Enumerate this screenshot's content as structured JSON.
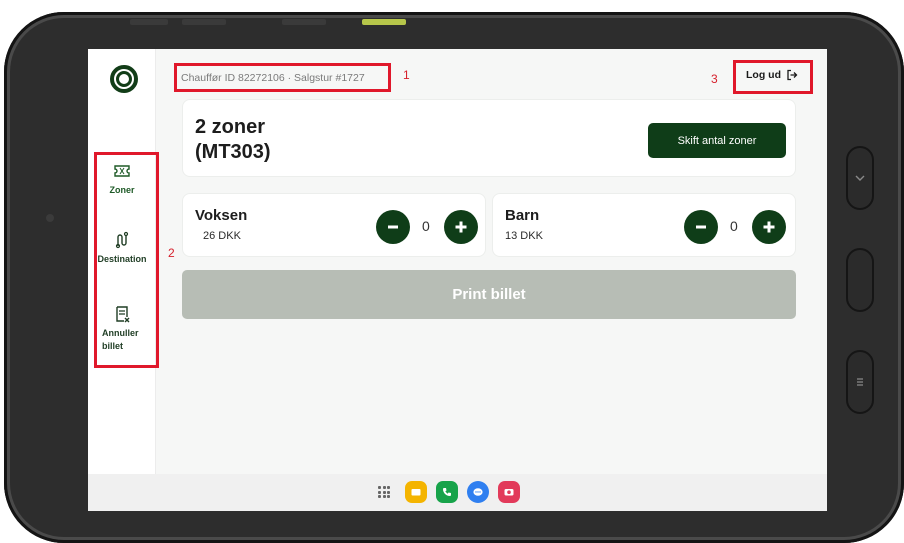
{
  "header": {
    "driver_info": "Chauffør ID 82272106 · Salgstur #1727",
    "logout_label": "Log ud"
  },
  "sidebar": {
    "items": [
      {
        "label": "Zoner",
        "icon": "ticket-icon",
        "active": true
      },
      {
        "label": "Destination",
        "icon": "route-icon",
        "active": false
      },
      {
        "label": "Annuller billet",
        "icon": "cancel-receipt-icon",
        "active": false
      }
    ]
  },
  "zone": {
    "title_line1": "2 zoner",
    "title_line2": "(MT303)",
    "change_button": "Skift antal zoner"
  },
  "passengers": [
    {
      "name": "Voksen",
      "price": "26 DKK",
      "count": "0"
    },
    {
      "name": "Barn",
      "price": "13 DKK",
      "count": "0"
    }
  ],
  "print_button": "Print billet",
  "annotations": [
    "1",
    "2",
    "3"
  ],
  "colors": {
    "primary": "#0f3d18",
    "disabled": "#b7bdb5",
    "annotation": "#e0182b"
  },
  "taskbar_apps": [
    "app-drawer-icon",
    "folder-icon",
    "phone-icon",
    "messages-icon",
    "camera-app-icon"
  ]
}
